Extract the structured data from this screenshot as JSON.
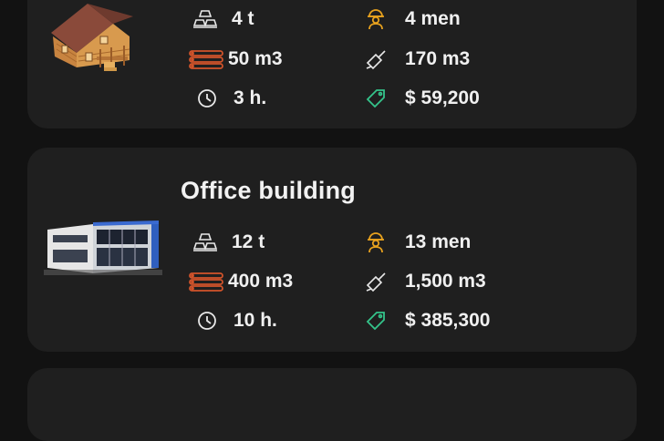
{
  "colors": {
    "background": "#121212",
    "card": "#1f1f1f",
    "text": "#f0f0f0",
    "icon_neutral": "#e8e8e8",
    "icon_timber": "#d2542b",
    "icon_worker": "#e8a21e",
    "icon_price": "#34c48b"
  },
  "icons": {
    "materials": "steel-ingots-icon",
    "timber": "timber-logs-icon",
    "time": "clock-icon",
    "workers": "worker-icon",
    "concrete": "trowel-icon",
    "price": "price-tag-icon"
  },
  "buildings": [
    {
      "stats": {
        "materials": "4 t",
        "timber": "50 m3",
        "time": "3 h.",
        "workers": "4 men",
        "concrete": "170 m3",
        "price": "$ 59,200"
      }
    },
    {
      "title": "Office building",
      "stats": {
        "materials": "12 t",
        "timber": "400 m3",
        "time": "10 h.",
        "workers": "13 men",
        "concrete": "1,500 m3",
        "price": "$ 385,300"
      }
    }
  ]
}
